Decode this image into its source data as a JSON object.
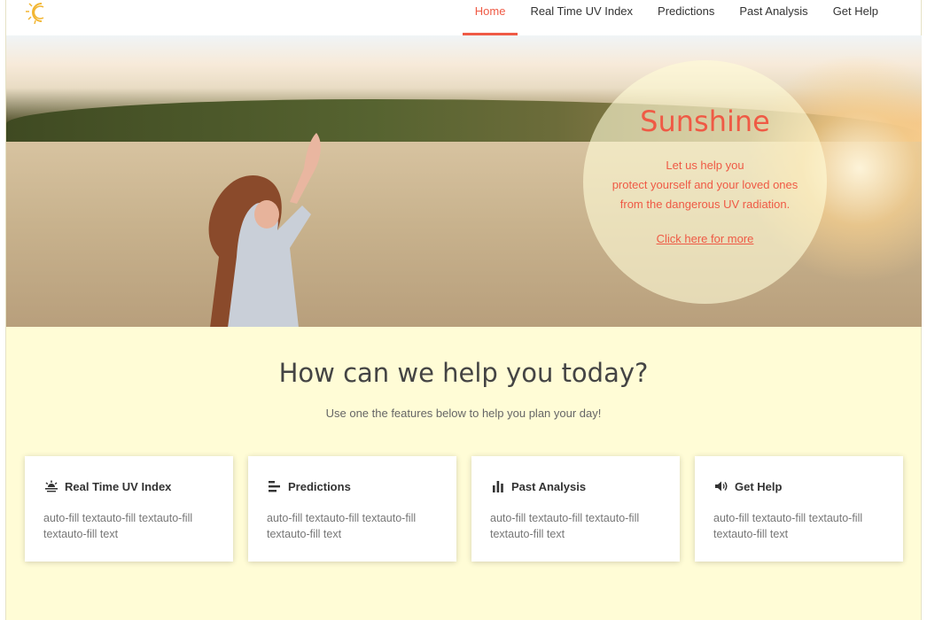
{
  "nav": {
    "items": [
      {
        "label": "Home",
        "active": true
      },
      {
        "label": "Real Time UV Index",
        "active": false
      },
      {
        "label": "Predictions",
        "active": false
      },
      {
        "label": "Past Analysis",
        "active": false
      },
      {
        "label": "Get Help",
        "active": false
      }
    ],
    "accent_color": "#ef5a45"
  },
  "hero": {
    "title": "Sunshine",
    "line1": "Let us help you",
    "line2": "protect yourself and your loved ones",
    "line3": "from the dangerous UV radiation.",
    "link": "Click here for more"
  },
  "section": {
    "title": "How can we help you today?",
    "subtitle": "Use one the features below to help you plan your day!"
  },
  "cards": [
    {
      "title": "Real Time UV Index",
      "icon": "sunrise-icon",
      "text": "auto-fill textauto-fill textauto-fill textauto-fill text"
    },
    {
      "title": "Predictions",
      "icon": "align-left-icon",
      "text": "auto-fill textauto-fill textauto-fill textauto-fill text"
    },
    {
      "title": "Past Analysis",
      "icon": "bar-chart-icon",
      "text": "auto-fill textauto-fill textauto-fill textauto-fill text"
    },
    {
      "title": "Get Help",
      "icon": "volume-icon",
      "text": "auto-fill textauto-fill textauto-fill textauto-fill text"
    }
  ],
  "colors": {
    "background": "#fffcd6",
    "accent": "#ef5a45"
  }
}
